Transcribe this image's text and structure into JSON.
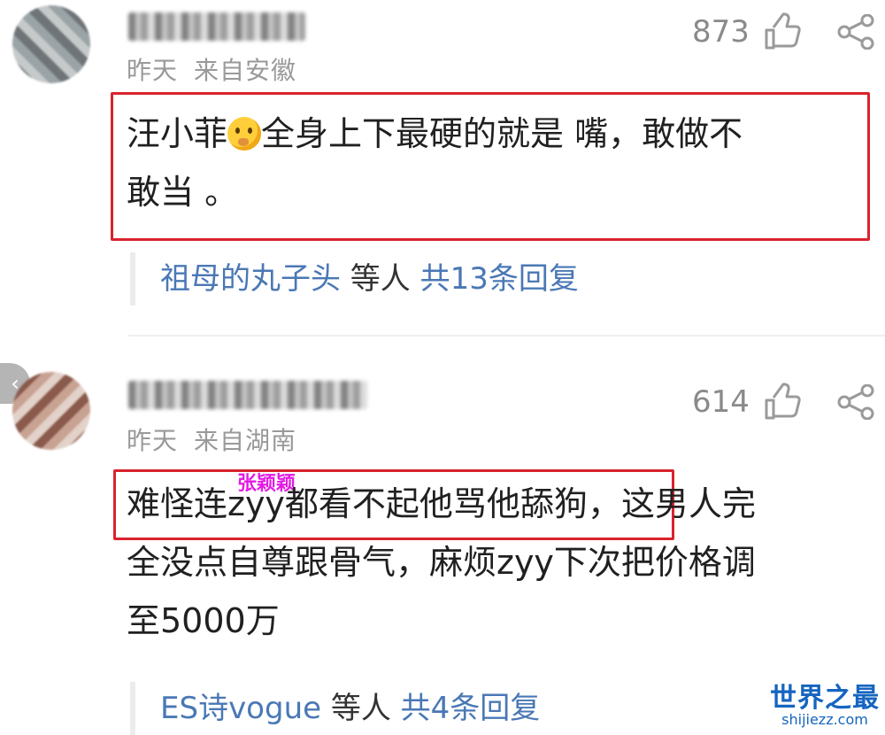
{
  "comments": [
    {
      "meta_time": "昨天",
      "meta_location": "来自安徽",
      "likes": "873",
      "text_part1": "汪小菲",
      "text_part2": "全身上下最硬的就是 嘴，敢做不",
      "text_line2": "敢当 。",
      "replies_user": "祖母的丸子头",
      "replies_mid": " 等人 ",
      "replies_count": "共13条回复"
    },
    {
      "meta_time": "昨天",
      "meta_location": "来自湖南",
      "likes": "614",
      "annotation": "张颖颖",
      "text_line1_boxed": "难怪连zyy都看不起他骂他舔狗",
      "text_line1_rest": "，这男人完",
      "text_line2": "全没点自尊跟骨气，麻烦zyy下次把价格调",
      "text_line3": "至5000万",
      "replies_user": "ES诗vogue",
      "replies_mid": " 等人 ",
      "replies_count": "共4条回复"
    }
  ],
  "watermark": {
    "title": "世界之最",
    "domain": "shijiezz.com"
  },
  "colors": {
    "highlight_box": "#d9232e",
    "link": "#4a78b5",
    "annotation": "#e21be2"
  }
}
